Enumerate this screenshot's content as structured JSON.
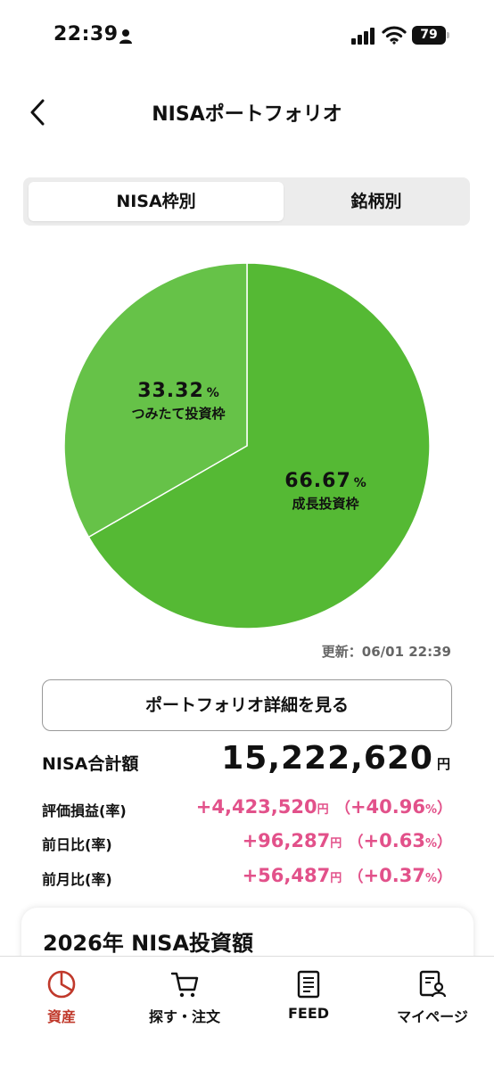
{
  "status_bar": {
    "time": "22:39",
    "battery": "79"
  },
  "header": {
    "title": "NISAポートフォリオ"
  },
  "tabs": [
    {
      "label": "NISA枠別",
      "active": true
    },
    {
      "label": "銘柄別",
      "active": false
    }
  ],
  "chart_data": {
    "type": "pie",
    "slices": [
      {
        "name": "成長投資枠",
        "value": 66.67,
        "color": "#55b934"
      },
      {
        "name": "つみたて投資枠",
        "value": 33.32,
        "color": "#66c248"
      }
    ],
    "unit": "%"
  },
  "updated": "更新：06/01 22:39",
  "detail_button": "ポートフォリオ詳細を見る",
  "total": {
    "label": "NISA合計額",
    "value": "15,222,620",
    "unit": "円"
  },
  "metrics": [
    {
      "label": "評価損益(率)",
      "value": "+4,423,520",
      "unit": "円",
      "rate": "+40.96",
      "rate_unit": "%"
    },
    {
      "label": "前日比(率)",
      "value": "+96,287",
      "unit": "円",
      "rate": "+0.63",
      "rate_unit": "%"
    },
    {
      "label": "前月比(率)",
      "value": "+56,487",
      "unit": "円",
      "rate": "+0.37",
      "rate_unit": "%"
    }
  ],
  "card": {
    "title": "2026年 NISA投資額"
  },
  "tab_bar": [
    {
      "label": "資産",
      "icon": "pie-chart-icon",
      "active": true,
      "color": "#c0392b"
    },
    {
      "label": "探す・注文",
      "icon": "cart-icon",
      "active": false
    },
    {
      "label": "FEED",
      "icon": "document-icon",
      "active": false
    },
    {
      "label": "マイページ",
      "icon": "profile-icon",
      "active": false
    }
  ]
}
